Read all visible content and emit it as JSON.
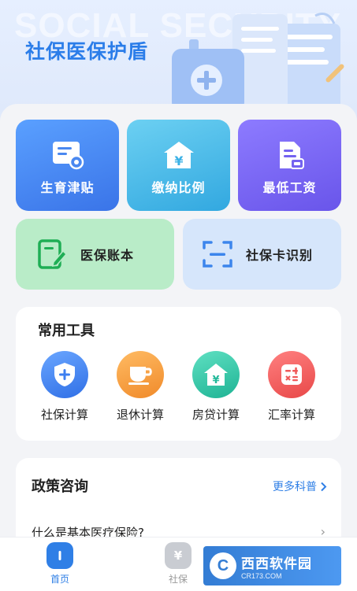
{
  "header": {
    "bg_text": "SOCIAL SECURITY",
    "title": "社保医保护盾"
  },
  "feature_tiles": [
    {
      "label": "生育津贴",
      "icon": "document-gear-icon"
    },
    {
      "label": "缴纳比例",
      "icon": "house-yuan-icon"
    },
    {
      "label": "最低工资",
      "icon": "document-wallet-icon"
    }
  ],
  "wide_tiles": [
    {
      "label": "医保账本",
      "icon": "edit-document-icon"
    },
    {
      "label": "社保卡识别",
      "icon": "scan-icon"
    }
  ],
  "tools": {
    "title": "常用工具",
    "items": [
      {
        "label": "社保计算",
        "icon": "shield-plus-icon",
        "color": "#3d7ff0"
      },
      {
        "label": "退休计算",
        "icon": "tea-cup-icon",
        "color": "#f39a3a"
      },
      {
        "label": "房贷计算",
        "icon": "house-yuan-icon",
        "color": "#2cc4a4"
      },
      {
        "label": "汇率计算",
        "icon": "calculator-icon",
        "color": "#ef5a5a"
      }
    ]
  },
  "policy": {
    "title": "政策咨询",
    "more_label": "更多科普",
    "question": "什么是基本医疗保险?"
  },
  "nav": {
    "items": [
      {
        "label": "首页",
        "icon": "home-icon",
        "active": true
      },
      {
        "label": "社保",
        "icon": "yuan-icon",
        "active": false
      }
    ]
  },
  "watermark": {
    "logo": "C",
    "main": "西西软件园",
    "sub": "CR173.COM"
  },
  "colors": {
    "accent": "#2b7de9",
    "active_nav": "#2f7fe6"
  }
}
